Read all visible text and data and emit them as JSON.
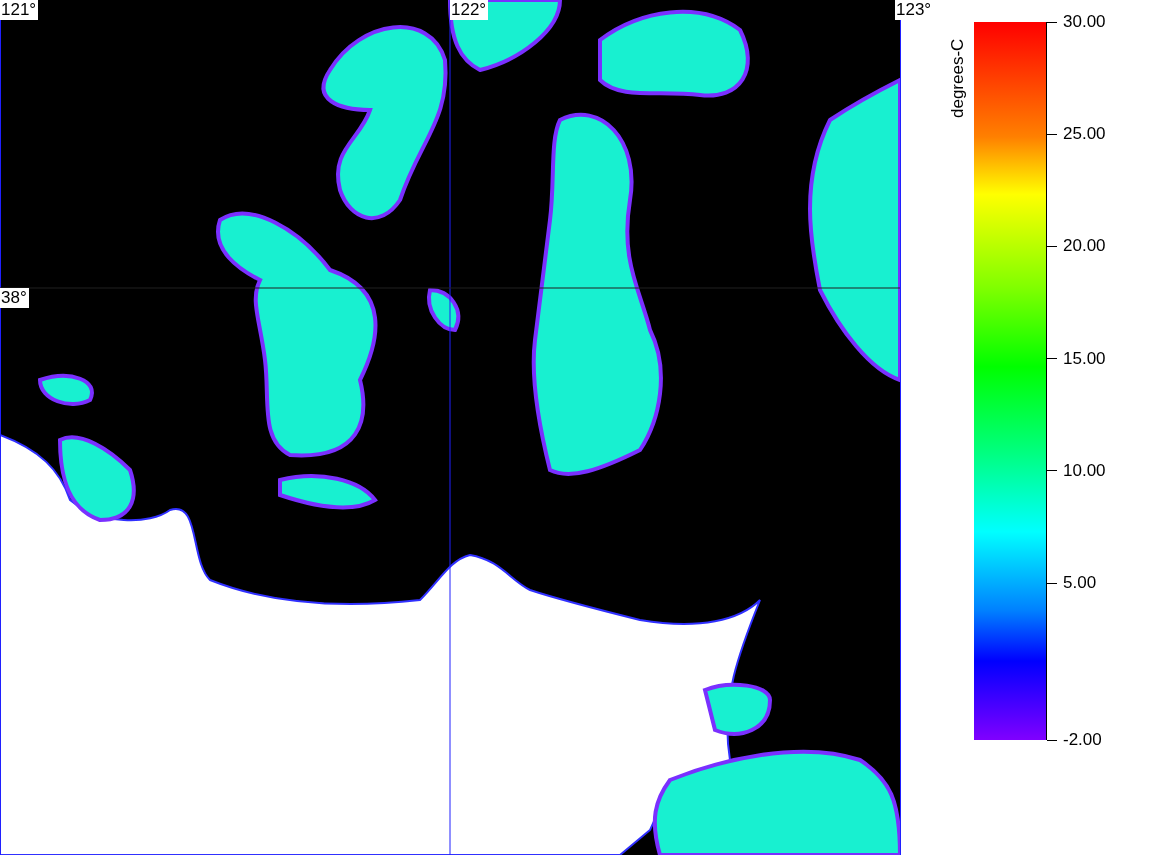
{
  "map": {
    "longitude_labels": [
      "121°",
      "122°",
      "123°"
    ],
    "latitude_labels": [
      "38°"
    ]
  },
  "colorbar": {
    "unit": "degrees-C",
    "ticks": [
      "30.00",
      "25.00",
      "20.00",
      "15.00",
      "10.00",
      "5.00",
      "-2.00"
    ]
  }
}
